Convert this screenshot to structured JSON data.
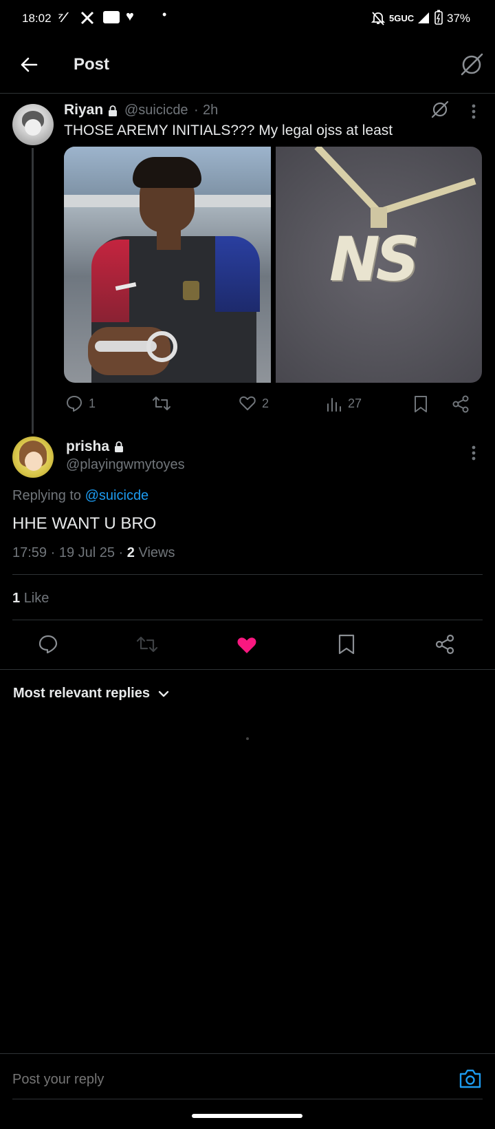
{
  "status_bar": {
    "time": "18:02",
    "network": "5GUC",
    "battery": "37%"
  },
  "header": {
    "title": "Post"
  },
  "original_post": {
    "name": "Riyan",
    "handle": "@suicicde",
    "time": "2h",
    "text": "THOSE AREMY INITIALS??? My legal ojss at least",
    "pendant_text": "NS",
    "replies": "1",
    "likes": "2",
    "views": "27"
  },
  "reply_post": {
    "name": "prisha",
    "handle": "@playingwmytoyes",
    "replying_to_label": "Replying to",
    "replying_to_handle": "@suicicde",
    "text": "HHE WANT U BRO",
    "timestamp": "17:59 · 19 Jul 25 · ",
    "views_count": "2",
    "views_label": "Views",
    "likes_count": "1",
    "likes_label": "Like"
  },
  "sort": {
    "label": "Most relevant replies"
  },
  "composer": {
    "placeholder": "Post your reply"
  },
  "colors": {
    "accent_blue": "#1d9bf0",
    "like_pink": "#f91880"
  }
}
